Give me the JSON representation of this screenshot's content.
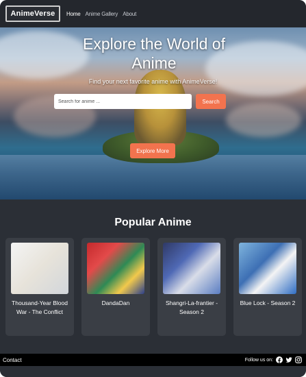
{
  "nav": {
    "logo_text": "AnimeVerse",
    "links": [
      "Home",
      "Anime Gallery",
      "About"
    ]
  },
  "hero": {
    "title": "Explore the World of Anime",
    "subtitle": "Find your next favorite anime with AnimeVerse!",
    "search_placeholder": "Search for anime ...",
    "search_button": "Search",
    "explore_button": "Explore More"
  },
  "popular": {
    "title": "Popular Anime",
    "cards": [
      {
        "title": "Thousand-Year Blood War - The Conflict"
      },
      {
        "title": "DandaDan"
      },
      {
        "title": "Shangri-La-frantier - Season 2"
      },
      {
        "title": "Blue Lock - Season 2"
      }
    ]
  },
  "footer": {
    "left": "Contact",
    "follow": "Follow us on:",
    "icons": [
      "facebook-icon",
      "twitter-icon",
      "instagram-icon"
    ]
  },
  "colors": {
    "accent": "#f2734e",
    "page_bg": "#2b2f36",
    "card_bg": "#3a3e45"
  }
}
